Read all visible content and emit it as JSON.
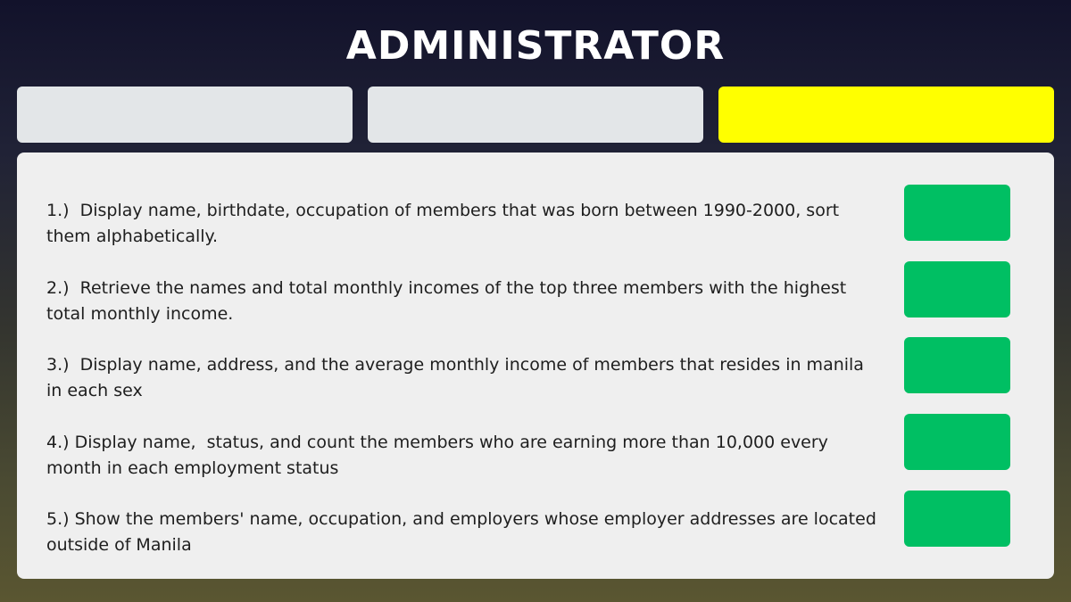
{
  "header": {
    "title": "ADMINISTRATOR"
  },
  "tabs": [
    {
      "label": "",
      "color": "#e3e6e8",
      "active": false
    },
    {
      "label": "",
      "color": "#e3e6e8",
      "active": false
    },
    {
      "label": "",
      "color": "#ffff00",
      "active": true
    }
  ],
  "queries": [
    {
      "text": "1.)  Display name, birthdate, occupation of members that was born between 1990-2000, sort them alphabetically.",
      "button_label": ""
    },
    {
      "text": "2.)  Retrieve the names and total monthly incomes of the top three members with the highest total monthly income.",
      "button_label": ""
    },
    {
      "text": "3.)  Display name, address, and the average monthly income of members that resides in manila in each sex",
      "button_label": ""
    },
    {
      "text": "4.) Display name,  status, and count the members who are earning more than 10,000 every month in each employment status",
      "button_label": ""
    },
    {
      "text": "5.) Show the members' name, occupation, and employers whose employer addresses are located outside of Manila",
      "button_label": ""
    }
  ],
  "colors": {
    "run_button": "#00bf63",
    "active_tab": "#ffff00",
    "inactive_tab": "#e3e6e8",
    "panel": "#efefef"
  }
}
